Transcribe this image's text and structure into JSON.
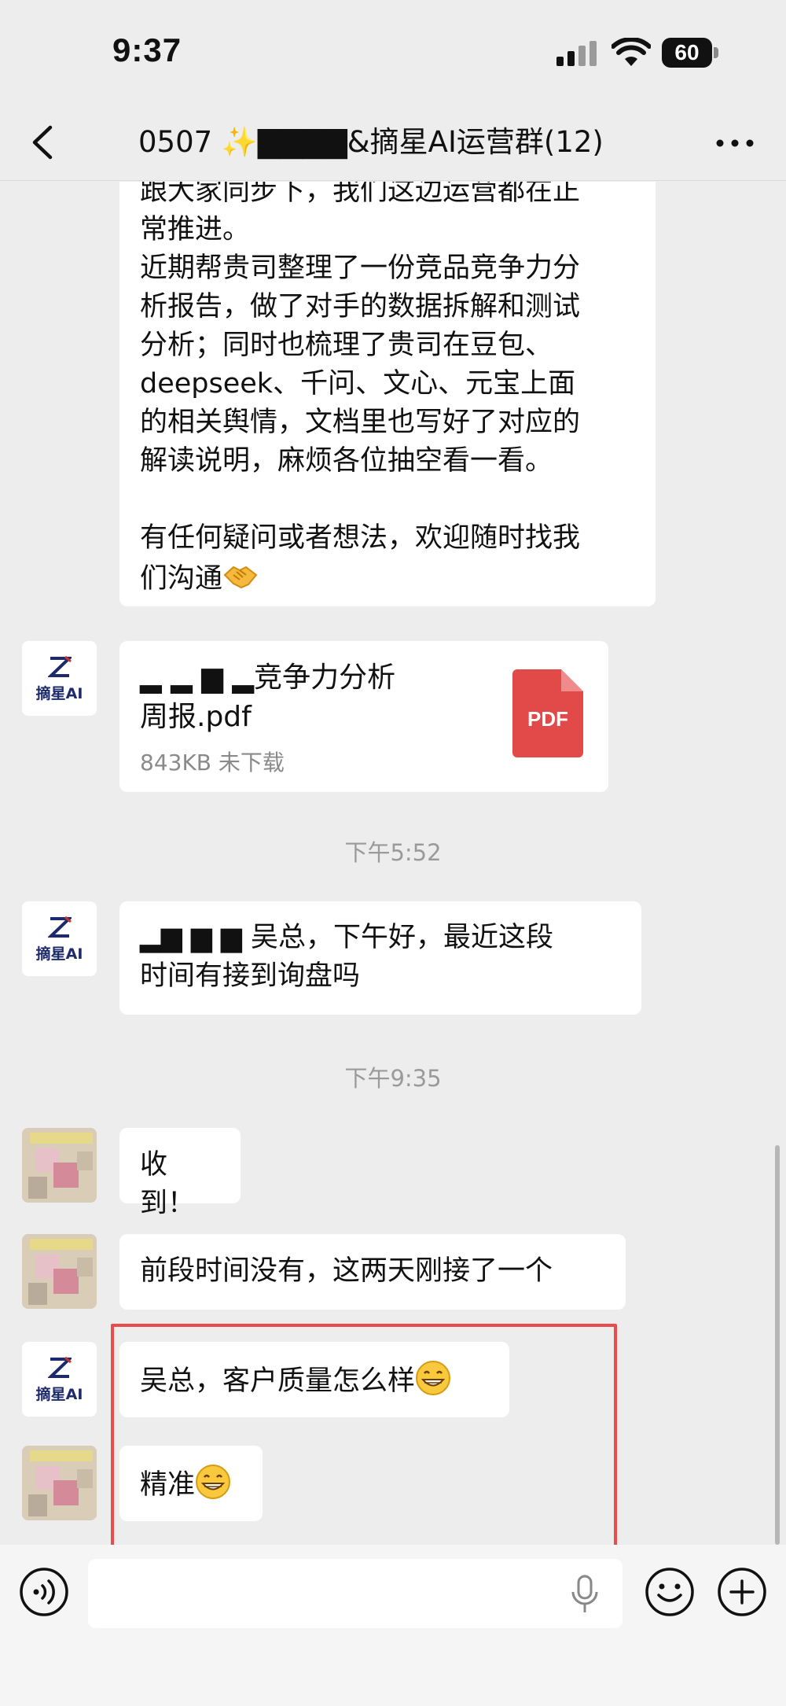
{
  "status_bar": {
    "time": "9:37",
    "battery": "60"
  },
  "header": {
    "title": "0507 ✨▇▇▇▇&摘星AI运营群(12)"
  },
  "messages": {
    "m1_lines": [
      "跟大家同步下，我们这边运营都在正",
      "常推进。",
      "近期帮贵司整理了一份竞品竞争力分",
      "析报告，做了对手的数据拆解和测试",
      "分析；同时也梳理了贵司在豆包、",
      "deepseek、千问、文心、元宝上面",
      "的相关舆情，文档里也写好了对应的",
      "解读说明，麻烦各位抽空看一看。",
      "",
      "有任何疑问或者想法，欢迎随时找我",
      "们沟通"
    ],
    "file": {
      "name_line1": "▂ ▂ ▆ ▂竞争力分析",
      "name_line2": "周报.pdf",
      "meta": "843KB  未下载",
      "badge": "PDF"
    },
    "ts1": "下午5:52",
    "m3_line1": "▂▆ ▆ ▆    吴总，下午好，最近这段",
    "m3_line2": "时间有接到询盘吗",
    "ts2": "下午9:35",
    "m4": "收到！",
    "m5": "前段时间没有，这两天刚接了一个",
    "m6": "吴总，客户质量怎么样",
    "m7": "精准"
  },
  "brand": {
    "avatar_text": "摘星AI",
    "color": "#1d2a6b"
  },
  "colors": {
    "highlight": "#e84c4c",
    "pdf": "#e24a4a",
    "background": "#ededed"
  },
  "icons": [
    "back-icon",
    "more-icon",
    "voice-icon",
    "mic-icon",
    "emoji-icon",
    "plus-icon",
    "pdf-icon",
    "handshake-emoji",
    "grin-emoji"
  ]
}
